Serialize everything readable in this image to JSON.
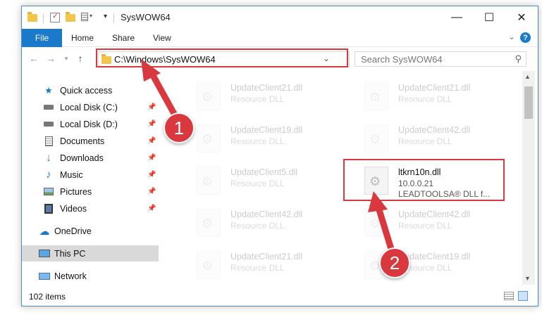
{
  "window": {
    "title": "SysWOW64"
  },
  "ribbon": {
    "file_tab": "File",
    "tabs": [
      "Home",
      "Share",
      "View"
    ],
    "help": "?"
  },
  "address": {
    "path": "C:\\Windows\\SysWOW64"
  },
  "search": {
    "placeholder": "Search SysWOW64"
  },
  "sidebar": {
    "items": [
      {
        "label": "Quick access",
        "icon": "star-icon",
        "pinned": false
      },
      {
        "label": "Local Disk (C:)",
        "icon": "drive-icon",
        "pinned": true
      },
      {
        "label": "Local Disk (D:)",
        "icon": "drive-icon",
        "pinned": true
      },
      {
        "label": "Documents",
        "icon": "document-icon",
        "pinned": true
      },
      {
        "label": "Downloads",
        "icon": "download-icon",
        "pinned": true
      },
      {
        "label": "Music",
        "icon": "music-icon",
        "pinned": true
      },
      {
        "label": "Pictures",
        "icon": "picture-icon",
        "pinned": true
      },
      {
        "label": "Videos",
        "icon": "video-icon",
        "pinned": true
      },
      {
        "label": "OneDrive",
        "icon": "cloud-icon",
        "pinned": false
      },
      {
        "label": "This PC",
        "icon": "computer-icon",
        "pinned": false,
        "selected": true
      },
      {
        "label": "Network",
        "icon": "network-icon",
        "pinned": false
      }
    ]
  },
  "files": [
    {
      "name": "UpdateClient21.dll",
      "line1": "Resource DLL",
      "line2": ""
    },
    {
      "name": "UpdateClient21.dll",
      "line1": "Resource DLL",
      "line2": ""
    },
    {
      "name": "UpdateClient19.dll",
      "line1": "Resource DLL",
      "line2": ""
    },
    {
      "name": "UpdateClient42.dll",
      "line1": "Resource DLL",
      "line2": ""
    },
    {
      "name": "UpdateClient5.dll",
      "line1": "Resource DLL",
      "line2": ""
    },
    {
      "name": "ltkrn10n.dll",
      "line1": "10.0.0.21",
      "line2": "LEADTOOLSA® DLL f...",
      "highlighted": true
    },
    {
      "name": "UpdateClient42.dll",
      "line1": "Resource DLL",
      "line2": ""
    },
    {
      "name": "UpdateClient42.dll",
      "line1": "Resource DLL",
      "line2": ""
    },
    {
      "name": "UpdateClient21.dll",
      "line1": "Resource DLL",
      "line2": ""
    },
    {
      "name": "UpdateClient19.dll",
      "line1": "Resource DLL",
      "line2": ""
    }
  ],
  "status": {
    "item_count": "102 items"
  },
  "callouts": [
    "1",
    "2"
  ],
  "colors": {
    "accent": "#1979ca",
    "highlight_red": "#d9383f"
  }
}
